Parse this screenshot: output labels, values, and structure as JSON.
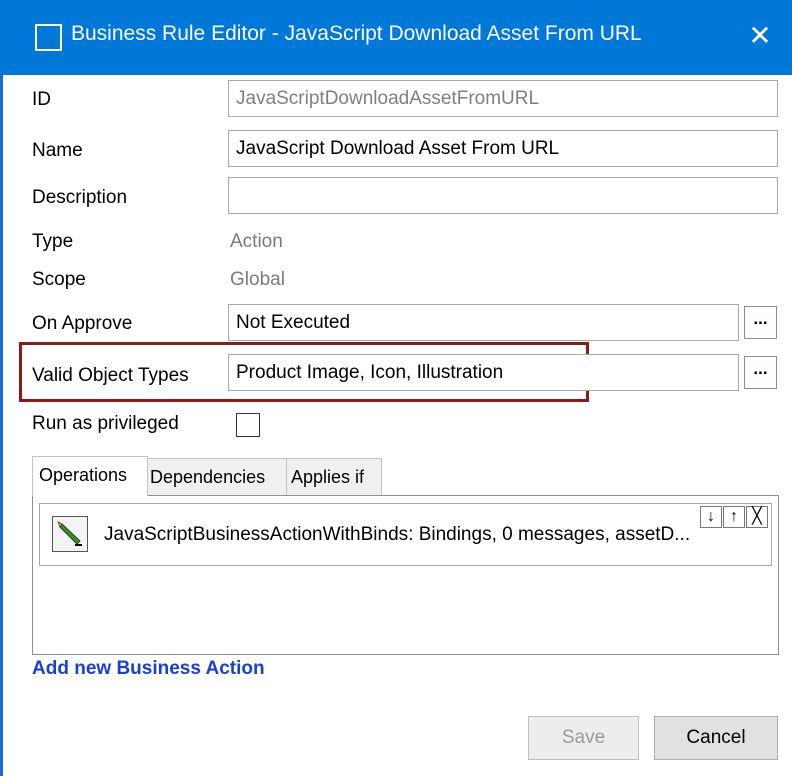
{
  "window": {
    "title": "Business Rule Editor - JavaScript Download Asset From URL",
    "close_glyph": "✕"
  },
  "form": {
    "id_label": "ID",
    "id_value": "JavaScriptDownloadAssetFromURL",
    "name_label": "Name",
    "name_value": "JavaScript Download Asset From URL",
    "description_label": "Description",
    "description_value": "",
    "type_label": "Type",
    "type_value": "Action",
    "scope_label": "Scope",
    "scope_value": "Global",
    "on_approve_label": "On Approve",
    "on_approve_value": "Not Executed",
    "valid_object_types_label": "Valid Object Types",
    "valid_object_types_value": "Product Image, Icon, Illustration",
    "run_privileged_label": "Run as privileged",
    "run_privileged_checked": false,
    "ellipsis": "..."
  },
  "tabs": [
    {
      "label": "Operations",
      "active": true
    },
    {
      "label": "Dependencies",
      "active": false
    },
    {
      "label": "Applies if",
      "active": false
    }
  ],
  "operations": [
    {
      "text": "JavaScriptBusinessActionWithBinds: Bindings, 0 messages, assetD..."
    }
  ],
  "op_controls": {
    "down": "↓",
    "up": "↑",
    "remove": "╳"
  },
  "add_action_label": "Add new Business Action",
  "buttons": {
    "save": "Save",
    "cancel": "Cancel"
  },
  "colors": {
    "title_bar": "#0078d7",
    "highlight": "#8b1a1a",
    "link": "#1a3fd8"
  },
  "icons": {
    "window": "window-icon",
    "operation": "edit-pencil-icon"
  }
}
